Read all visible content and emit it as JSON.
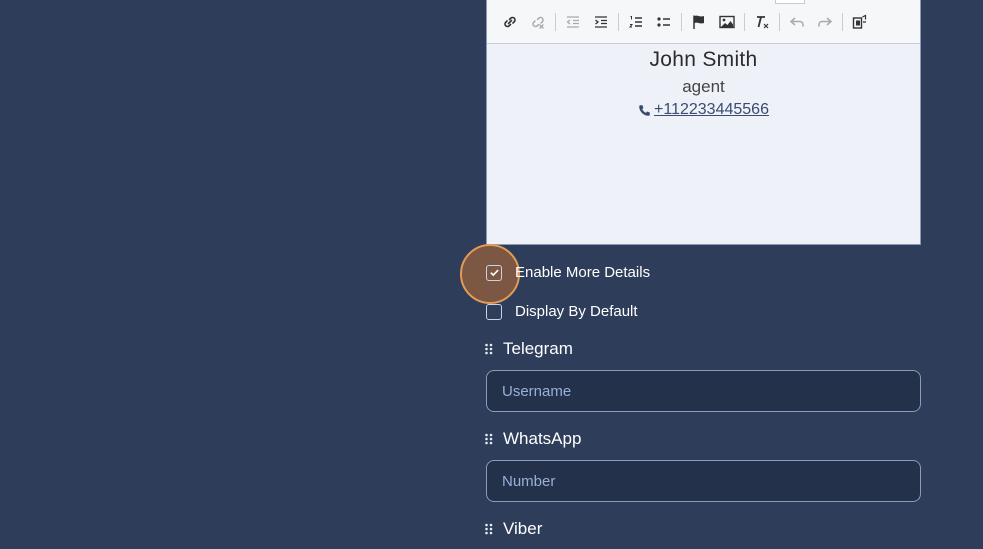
{
  "editor": {
    "toolbar": {
      "buttons": [
        {
          "name": "link-icon",
          "enabled": true
        },
        {
          "name": "unlink-icon",
          "enabled": false
        },
        {
          "name": "outdent-icon",
          "enabled": false
        },
        {
          "name": "indent-icon",
          "enabled": true
        },
        {
          "name": "numbered-list-icon",
          "enabled": true
        },
        {
          "name": "bulleted-list-icon",
          "enabled": true
        },
        {
          "name": "flag-icon",
          "enabled": true
        },
        {
          "name": "image-icon",
          "enabled": true
        },
        {
          "name": "clear-format-icon",
          "enabled": true
        },
        {
          "name": "undo-icon",
          "enabled": false
        },
        {
          "name": "redo-icon",
          "enabled": false
        },
        {
          "name": "source-icon",
          "enabled": true
        }
      ]
    },
    "signature": {
      "name": "John Smith",
      "role": "agent",
      "phone": "+112233445566"
    }
  },
  "options": {
    "enable_more_details": {
      "label": "Enable More Details",
      "checked": true
    },
    "display_by_default": {
      "label": "Display By Default",
      "checked": false
    }
  },
  "fields": {
    "telegram": {
      "title": "Telegram",
      "placeholder": "Username"
    },
    "whatsapp": {
      "title": "WhatsApp",
      "placeholder": "Number"
    },
    "viber": {
      "title": "Viber"
    }
  },
  "colors": {
    "background": "#2e3d5a",
    "input_background": "#24314a",
    "focus_ring": "#e39a55"
  }
}
